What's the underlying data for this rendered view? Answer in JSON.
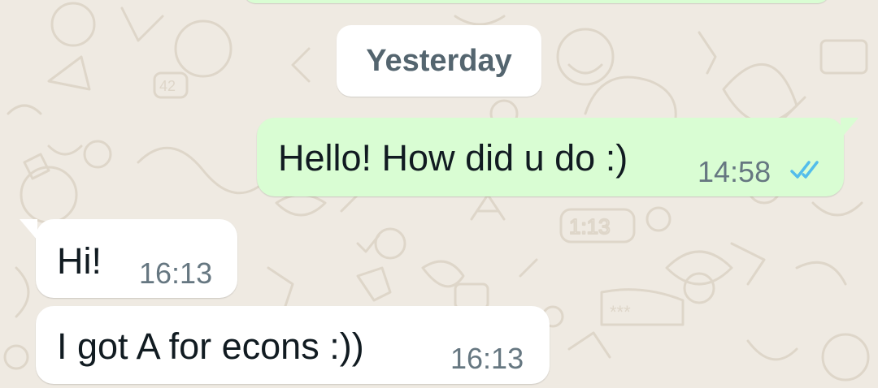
{
  "date_divider": "Yesterday",
  "messages": [
    {
      "direction": "outgoing",
      "text": "Hello! How did u do :)",
      "time": "14:58",
      "status": "read",
      "status_icon": "double-check-icon"
    },
    {
      "direction": "incoming",
      "text": "Hi!",
      "time": "16:13"
    },
    {
      "direction": "incoming",
      "text": "I got A for econs :))",
      "time": "16:13"
    }
  ],
  "colors": {
    "chat_background": "#efeae2",
    "outgoing_bubble": "#d9fdd3",
    "incoming_bubble": "#ffffff",
    "read_ticks": "#53bdeb",
    "timestamp": "#667781",
    "date_chip_text": "#54656f"
  }
}
